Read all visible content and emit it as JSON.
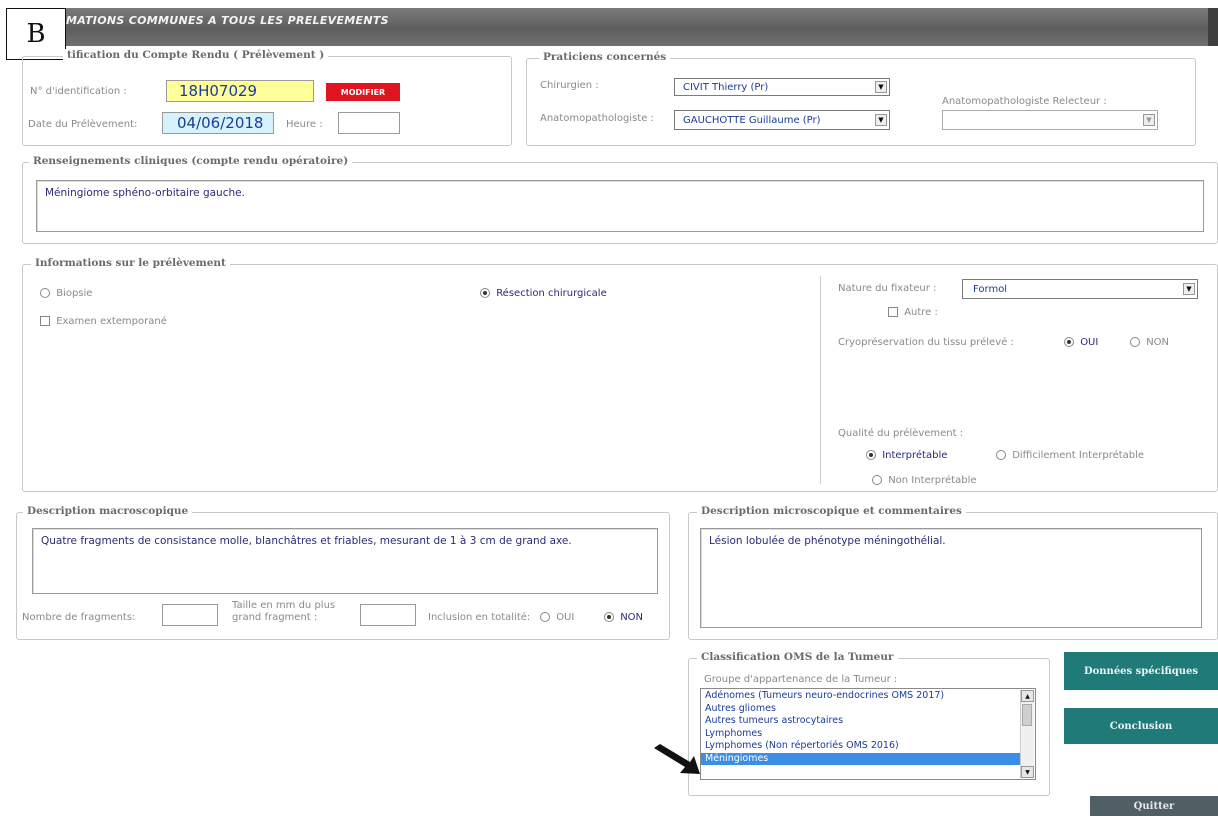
{
  "title": "MATIONS COMMUNES A TOUS LES PRELEVEMENTS",
  "corner_label": "B",
  "identification": {
    "legend": "tification du Compte Rendu ( Prélèvement )",
    "id_label": "N° d'identification :",
    "id_value": "18H07029",
    "modify_button": "MODIFIER",
    "date_label": "Date du Prélèvement:",
    "date_value": "04/06/2018",
    "time_label": "Heure :",
    "time_value": ""
  },
  "practitioners": {
    "legend": "Praticiens concernés",
    "surgeon_label": "Chirurgien :",
    "surgeon_value": "CIVIT Thierry (Pr)",
    "pathologist_label": "Anatomopathologiste :",
    "pathologist_value": "GAUCHOTTE Guillaume (Pr)",
    "reviewer_label": "Anatomopathologiste Relecteur :",
    "reviewer_value": ""
  },
  "clinical": {
    "legend": "Renseignements cliniques (compte rendu opératoire)",
    "text": "Méningiome sphéno-orbitaire gauche."
  },
  "sample_info": {
    "legend": "Informations sur le prélèvement",
    "biopsy_label": "Biopsie",
    "resection_label": "Résection chirurgicale",
    "extemp_label": "Examen extemporané",
    "fixative_label": "Nature du fixateur :",
    "fixative_value": "Formol",
    "other_label": "Autre :",
    "cryo_label": "Cryopréservation du tissu prélevé :",
    "yes": "OUI",
    "no": "NON",
    "quality_label": "Qualité du prélèvement :",
    "quality_opt1": "Interprétable",
    "quality_opt2": "Difficilement Interprétable",
    "quality_opt3": "Non Interprétable"
  },
  "macro": {
    "legend": "Description macroscopique",
    "text": "Quatre fragments de consistance molle, blanchâtres et friables, mesurant de 1 à 3 cm de grand axe.",
    "fragments_label": "Nombre de fragments:",
    "size_label_1": "Taille en mm du plus",
    "size_label_2": "grand fragment :",
    "inclusion_label": "Inclusion en totalité:",
    "yes": "OUI",
    "no": "NON"
  },
  "micro": {
    "legend": "Description microscopique et commentaires",
    "text": "Lésion lobulée de phénotype méningothélial."
  },
  "who": {
    "legend": "Classification OMS de la Tumeur",
    "group_label": "Groupe d'appartenance de la Tumeur :",
    "items": [
      "Adénomes (Tumeurs neuro-endocrines OMS 2017)",
      "Autres gliomes",
      "Autres tumeurs astrocytaires",
      "Lymphomes",
      "Lymphomes (Non répertoriés OMS 2016)",
      "Méningiomes"
    ],
    "selected_index": 5
  },
  "buttons": {
    "specific": "Données spécifiques",
    "conclusion": "Conclusion",
    "quit": "Quitter"
  },
  "icons": {
    "pointer": "arrow-pointer-icon",
    "dropdown": "chevron-down-icon"
  }
}
